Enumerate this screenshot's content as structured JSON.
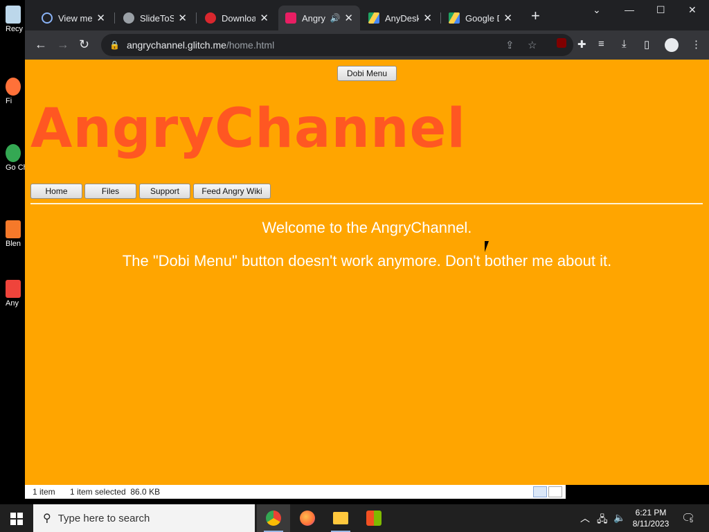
{
  "desktop": {
    "icons": [
      {
        "label": "Recy",
        "color": "#4aa3df"
      },
      {
        "label": "Fi",
        "color": "#ff7139"
      },
      {
        "label": "Go Ch",
        "color": "#34a853"
      },
      {
        "label": "Blen",
        "color": "#f5792a"
      },
      {
        "label": "Any",
        "color": "#ef443b"
      }
    ]
  },
  "browser": {
    "tabs": [
      {
        "title": "View mess",
        "icon": "at-sign-icon",
        "color": "#8ab4f8"
      },
      {
        "title": "SlideToShi",
        "icon": "globe-icon",
        "color": "#9aa0a6"
      },
      {
        "title": "Download",
        "icon": "mega-icon",
        "color": "#d9272e"
      },
      {
        "title": "Angry",
        "icon": "angry-face-icon",
        "color": "#e91e63",
        "active": true
      },
      {
        "title": "AnyDesk.e",
        "icon": "google-drive-icon",
        "color": "#1fa463"
      },
      {
        "title": "Google Dr",
        "icon": "google-drive-icon",
        "color": "#1fa463"
      }
    ],
    "address": {
      "host": "angrychannel.glitch.me",
      "path": "/home.html"
    }
  },
  "page": {
    "top_button": "Dobi Menu",
    "logo": "AngryChannel",
    "nav": [
      "Home",
      "Files",
      "Support",
      "Feed Angry Wiki"
    ],
    "welcome": "Welcome to the AngryChannel.",
    "notice": "The \"Dobi Menu\" button doesn't work anymore. Don't bother me about it.",
    "background": "#ffa500",
    "logo_color": "#ff5722"
  },
  "explorer_status": {
    "count": "1 item",
    "selection": "1 item selected  86.0 KB"
  },
  "taskbar": {
    "search_placeholder": "Type here to search",
    "time": "6:21 PM",
    "date": "8/11/2023",
    "notifications": "5"
  }
}
